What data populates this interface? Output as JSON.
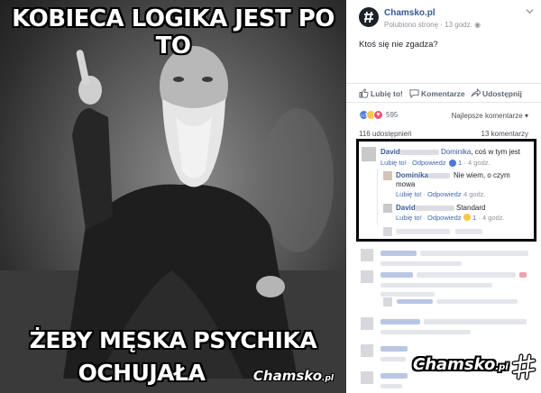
{
  "meme": {
    "top_caption": "KOBIECA LOGIKA JEST PO TO",
    "bottom_line1": "ŻEBY MĘSKA PSYCHIKA",
    "bottom_line2": "OCHUJAŁA",
    "watermark_name": "Chamsko",
    "watermark_suffix": ".pl"
  },
  "post": {
    "page_name": "Chamsko.pl",
    "liked_label": "Polubiono stronę",
    "separator": " · ",
    "time": "13 godz.",
    "more_icon": "chevron-down-icon",
    "text": "Ktoś się nie zgadza?"
  },
  "actions": {
    "like": "Lubię to!",
    "comment": "Komentarze",
    "share": "Udostępnij"
  },
  "reactions": {
    "count": "595",
    "types": [
      "like",
      "haha",
      "love"
    ],
    "sort_label": "Najlepsze komentarze",
    "sort_icon": "caret-down-icon"
  },
  "stats": {
    "shares": "116 udostępnień",
    "comments": "13 komentarzy"
  },
  "comments": [
    {
      "author": "David",
      "mention": "Dominika",
      "text": ", coś w tym jest",
      "like": "Lubię to!",
      "reply": "Odpowiedz",
      "reaction_count": "1",
      "time": "4 godz."
    }
  ],
  "replies": [
    {
      "author": "Dominika",
      "text_line1": "Nie wiem, o czym",
      "text_line2": "mowa",
      "like": "Lubię to!",
      "reply": "Odpowiedz",
      "time": "4 godz."
    },
    {
      "author": "David",
      "text": "Standard",
      "like": "Lubię to!",
      "reply": "Odpowiedz",
      "reaction_count": "1",
      "time": "4 godz."
    }
  ],
  "brand": {
    "footer_watermark_name": "Chamsko",
    "footer_watermark_suffix": ".pl",
    "link_color": "#365899",
    "action_color": "#4267b2",
    "meta_color": "#90949c"
  }
}
